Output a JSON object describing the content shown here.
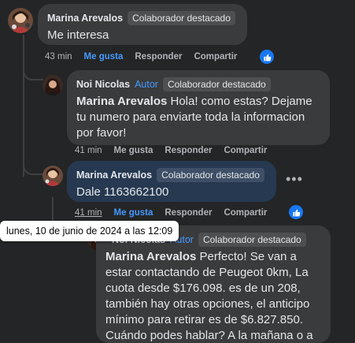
{
  "comments": [
    {
      "author": "Marina Arevalos",
      "badge": "Colaborador destacado",
      "text": "Me interesa",
      "actions": {
        "time": "43 min",
        "like": "Me gusta",
        "reply": "Responder",
        "share": "Compartir"
      }
    },
    {
      "author": "Noi Nicolas",
      "role": "Autor",
      "badge": "Colaborador destacado",
      "mention": "Marina Arevalos",
      "text": " Hola! como estas? Dejame tu numero para enviarte toda la informacion por favor!",
      "actions": {
        "time": "41 min",
        "like": "Me gusta",
        "reply": "Responder",
        "share": "Compartir"
      }
    },
    {
      "author": "Marina Arevalos",
      "badge": "Colaborador destacado",
      "text": "Dale 1163662100",
      "actions": {
        "time": "41 min",
        "like": "Me gusta",
        "reply": "Responder",
        "share": "Compartir"
      }
    },
    {
      "author": "Noi Nicolas",
      "role": "Autor",
      "badge": "Colaborador destacado",
      "mention": "Marina Arevalos",
      "text": " Perfecto! Se van a estar contactando de Peugeot 0km, La cuota desde $176.098. es de un 208, también hay otras opciones, el anticipo mínimo para retirar es de $6.827.850. Cuándo podes hablar? A la mañana o a la tarde?"
    }
  ],
  "tooltip": "lunes, 10 de junio de 2024 a las 12:09",
  "colors": {
    "background": "#242526",
    "bubble": "#3a3b3c",
    "highlight": "#263951",
    "accent": "#4599ff",
    "like": "#1877f2"
  }
}
